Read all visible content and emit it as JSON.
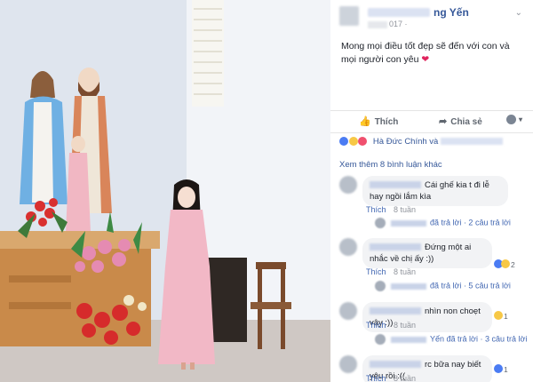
{
  "post": {
    "author_name_visible": "ng Yến",
    "time_visible": "017 ·",
    "status_text": "Mong mọi điều tốt đẹp sẽ đến với con và mọi người con yêu",
    "heart_emoji": "❤",
    "caret": "⌄"
  },
  "actions": {
    "like_label": "Thích",
    "share_label": "Chia sẻ",
    "like_icon": "👍",
    "share_icon": "➦",
    "menu_caret": "▾"
  },
  "reactions": {
    "names_visible": "Hà Đức Chính và"
  },
  "comments_header": {
    "view_more": "Xem thêm 8 bình luận khác"
  },
  "comments": [
    {
      "text": "Cái ghế kia t đi lễ hay ngồi lắm kìa",
      "like": "Thích",
      "time": "8 tuần",
      "reply_text": "đã trả lời",
      "reply_count": "· 2 câu trả lời"
    },
    {
      "text": "Đứng một ai nhắc về chị ấy :))",
      "like": "Thích",
      "time": "8 tuần",
      "reaction_count": "2",
      "reply_text": "đã trả lời",
      "reply_count": "· 5 câu trả lời"
    },
    {
      "text": "nhìn non choẹt vậy :))",
      "like": "Thích",
      "time": "8 tuần",
      "reaction_count": "1",
      "reply_name": "Yến",
      "reply_text": "đã trả lời",
      "reply_count": "· 3 câu trả lời"
    },
    {
      "text": "rc bữa nay biết yêu rồi :((",
      "like": "Thích",
      "time": "8 tuần",
      "reaction_count": "1"
    }
  ],
  "colors": {
    "link_blue": "#365899",
    "action_blue": "#4267b2",
    "muted_gray": "#90949c",
    "heart_red": "#e0245e"
  }
}
